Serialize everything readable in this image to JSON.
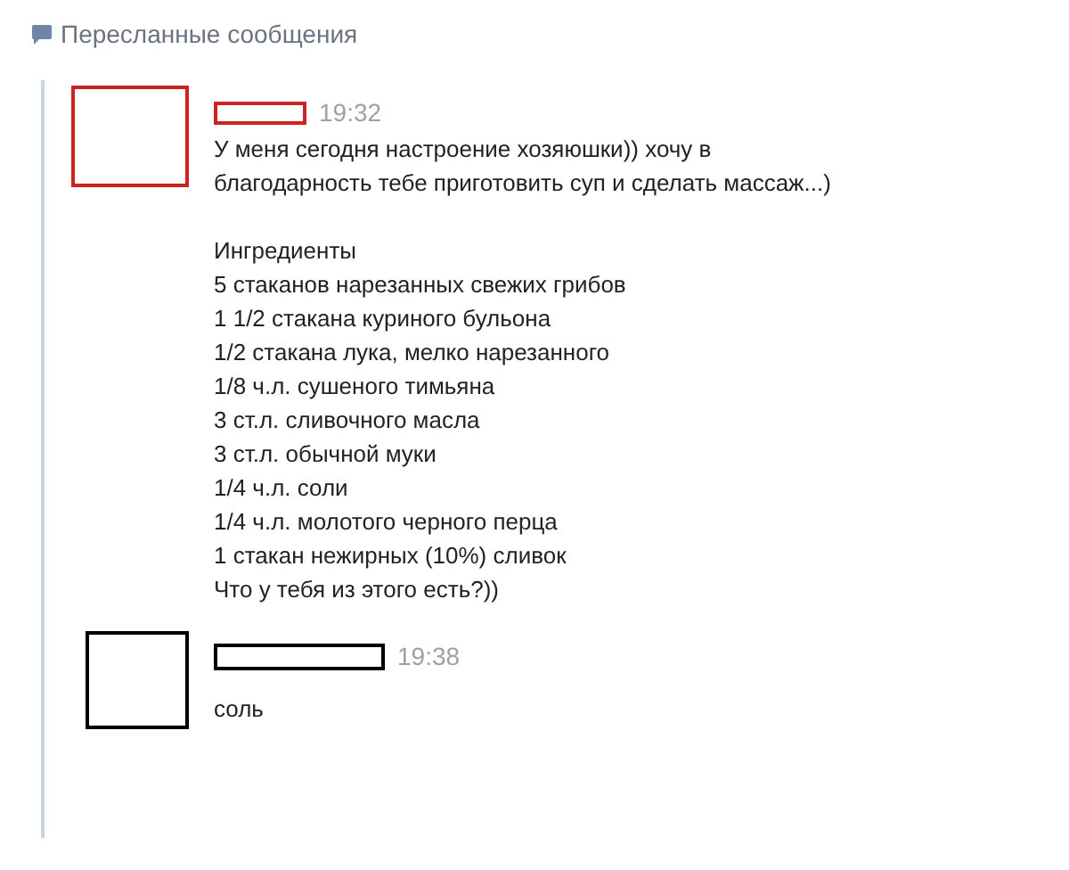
{
  "header": {
    "title": "Пересланные сообщения"
  },
  "messages": [
    {
      "color": "#cc2222",
      "time": "19:32",
      "paragraphs": [
        [
          "У меня сегодня настроение хозяюшки)) хочу в",
          "благодарность тебе приготовить суп и сделать массаж...)"
        ],
        [
          "Ингредиенты",
          "5 стаканов нарезанных свежих грибов",
          "1 1/2 стакана куриного бульона",
          "1/2 стакана лука, мелко нарезанного",
          "1/8 ч.л. сушеного тимьяна",
          "3 ст.л. сливочного масла",
          "3 ст.л. обычной муки",
          "1/4 ч.л. соли",
          "1/4 ч.л. молотого черного перца",
          "1 стакан нежирных (10%) сливок",
          "Что у тебя из этого есть?))"
        ]
      ]
    },
    {
      "color": "#000000",
      "time": "19:38",
      "paragraphs": [
        [
          "соль"
        ]
      ]
    }
  ]
}
